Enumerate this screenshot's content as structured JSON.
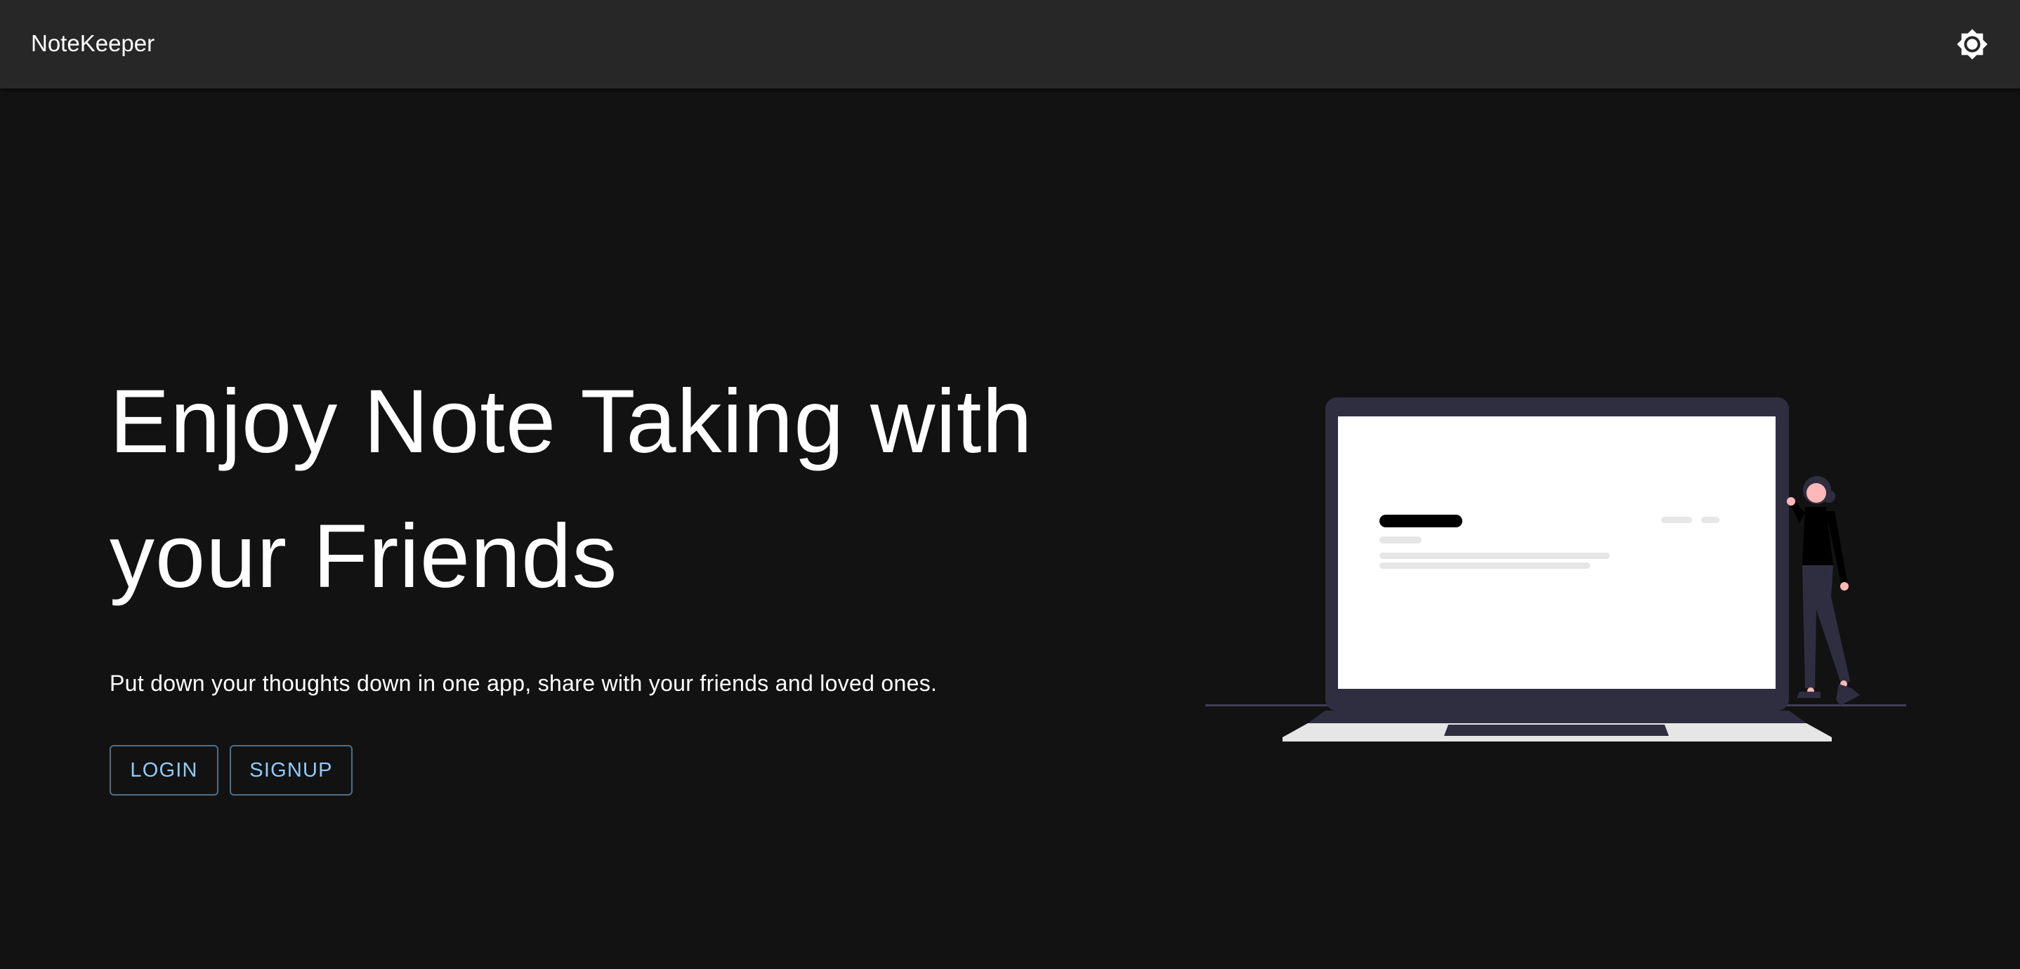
{
  "appbar": {
    "title": "NoteKeeper",
    "theme_toggle_icon": "brightness-icon"
  },
  "hero": {
    "title": "Enjoy Note Taking with your Friends",
    "subtitle": "Put down your thoughts down in one app, share with your friends and loved ones.",
    "login_label": "LOGIN",
    "signup_label": "SIGNUP"
  },
  "illustration": {
    "icon": "laptop-person-illustration"
  },
  "colors": {
    "background": "#121212",
    "appbar": "#272727",
    "accent": "#90caf9",
    "text": "#ffffff",
    "illustration_dark": "#2f2e41"
  }
}
